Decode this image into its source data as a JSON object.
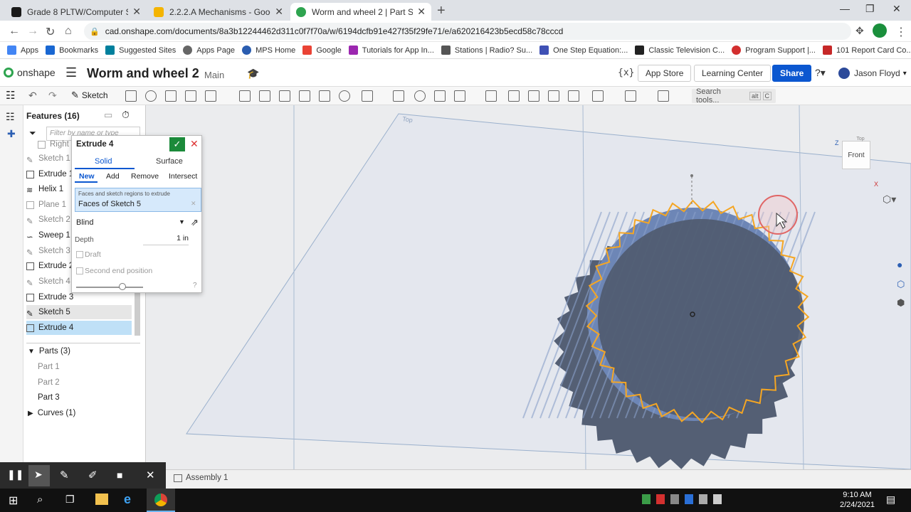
{
  "browser": {
    "tabs": [
      {
        "title": "Grade 8 PLTW/Computer Science",
        "color": "#1a1a1a"
      },
      {
        "title": "2.2.2.A Mechanisms - Google Sli",
        "color": "#f4b400"
      },
      {
        "title": "Worm and wheel 2 | Part Studio 1",
        "color": "#2ea44f"
      }
    ],
    "url": "cad.onshape.com/documents/8a3b12244462d311c0f7f70a/w/6194dcfb91e427f35f29fe71/e/a620216423b5ecd58c78cccd",
    "bookmarks": [
      "Apps",
      "Bookmarks",
      "Suggested Sites",
      "Apps Page",
      "MPS Home",
      "Google",
      "Tutorials for App In...",
      "Stations | Radio? Su...",
      "One Step Equation:...",
      "Classic Television C...",
      "Program Support |...",
      "101 Report Card Co..."
    ]
  },
  "onshape": {
    "logo": "onshape",
    "doc_title": "Worm and wheel 2",
    "branch": "Main",
    "app_store": "App Store",
    "learning_center": "Learning Center",
    "share": "Share",
    "user": "Jason Floyd",
    "sketch_label": "Sketch",
    "search_tools": "Search tools...",
    "search_shortcut_1": "alt",
    "search_shortcut_2": "C"
  },
  "features": {
    "title": "Features (16)",
    "filter_placeholder": "Filter by name or type",
    "items": [
      {
        "label": "Right",
        "dim": true
      },
      {
        "label": "Sketch 1",
        "dim": true
      },
      {
        "label": "Extrude 1",
        "dim": false
      },
      {
        "label": "Helix 1",
        "dim": false
      },
      {
        "label": "Plane 1",
        "dim": true
      },
      {
        "label": "Sketch 2",
        "dim": true
      },
      {
        "label": "Sweep 1",
        "dim": false
      },
      {
        "label": "Sketch 3",
        "dim": true
      },
      {
        "label": "Extrude 2",
        "dim": false
      },
      {
        "label": "Sketch 4",
        "dim": true
      },
      {
        "label": "Extrude 3",
        "dim": false
      },
      {
        "label": "Sketch 5",
        "dim": false
      },
      {
        "label": "Extrude 4",
        "dim": false
      }
    ],
    "parts_header": "Parts (3)",
    "parts": [
      "Part 1",
      "Part 2",
      "Part 3"
    ],
    "curves_header": "Curves (1)"
  },
  "extrude": {
    "title": "Extrude 4",
    "tab_solid": "Solid",
    "tab_surface": "Surface",
    "ops": [
      "New",
      "Add",
      "Remove",
      "Intersect"
    ],
    "faces_label": "Faces and sketch regions to extrude",
    "faces_value": "Faces of Sketch 5",
    "end_type": "Blind",
    "depth_label": "Depth",
    "depth_value": "1 in",
    "draft": "Draft",
    "second_end": "Second end position"
  },
  "viewport": {
    "plane_label": "Top",
    "viewcube_top": "Top",
    "viewcube_front": "Front",
    "axis_z": "Z",
    "axis_x": "X"
  },
  "bottom": {
    "assembly_tab": "Assembly 1"
  },
  "taskbar": {
    "time": "9:10 AM",
    "date": "2/24/2021"
  },
  "colors": {
    "accent": "#0b57d0",
    "share": "#0b57d0",
    "selection": "#bfe0f7",
    "sketch_edge": "#f5a623",
    "gear_face": "#6d86b6",
    "gear_dark": "#545f74"
  }
}
